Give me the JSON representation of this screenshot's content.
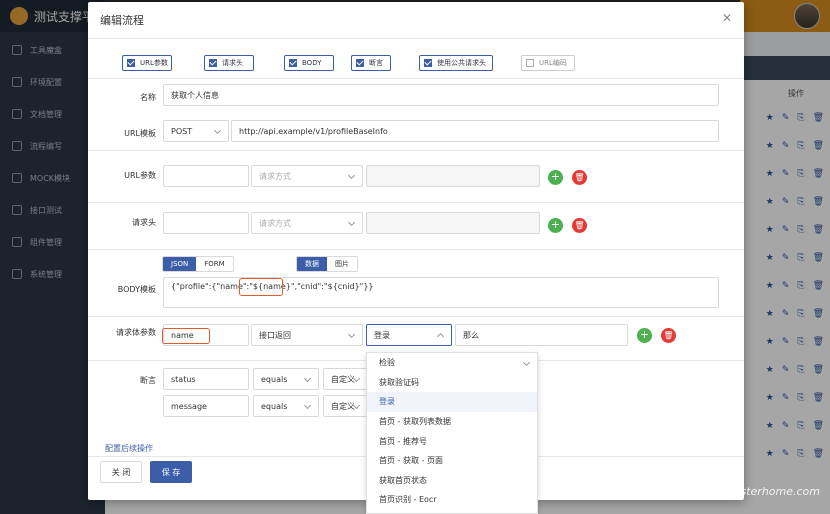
{
  "app": {
    "brand": "测试支撑平"
  },
  "sidebar": {
    "items": [
      {
        "label": "工具魔盒",
        "icon": "gear-icon"
      },
      {
        "label": "环境配置",
        "icon": "send-icon"
      },
      {
        "label": "文档管理",
        "icon": "doc-icon"
      },
      {
        "label": "流程编写",
        "icon": "flow-icon"
      },
      {
        "label": "MOCK模块",
        "icon": "mock-icon"
      },
      {
        "label": "接口测试",
        "icon": "grid-icon"
      },
      {
        "label": "组件管理",
        "icon": "tree-icon"
      },
      {
        "label": "系统管理",
        "icon": "list-icon"
      }
    ]
  },
  "background": {
    "op_header": "操作"
  },
  "modal": {
    "title": "编辑流程",
    "checkboxes": [
      {
        "label": "URL参数",
        "checked": true
      },
      {
        "label": "请求头",
        "checked": true
      },
      {
        "label": "BODY",
        "checked": true
      },
      {
        "label": "断言",
        "checked": true
      },
      {
        "label": "使用公共请求头",
        "checked": true
      },
      {
        "label": "URL编码",
        "checked": false
      }
    ],
    "name": {
      "label": "名称",
      "value": "获取个人信息"
    },
    "url": {
      "label": "URL模板",
      "method": "POST",
      "value": "http://api.example/v1/profileBaseInfo"
    },
    "url_params": {
      "label": "URL参数",
      "mode_placeholder": "请求方式"
    },
    "headers": {
      "label": "请求头",
      "mode_placeholder": "请求方式"
    },
    "body": {
      "label": "BODY模板",
      "tabs_format": [
        "JSON",
        "FORM"
      ],
      "tabs_type": [
        "数据",
        "图片"
      ],
      "value": "{\"profile\":{\"name\":\"${name}\",\"cnid\":\"${cnid}\"}}"
    },
    "body_params": {
      "label": "请求体参数",
      "name": "name",
      "source": "接口返回",
      "flow": "登录",
      "target": "那么"
    },
    "assert": {
      "label": "断言",
      "rows": [
        {
          "field": "status",
          "op": "equals",
          "kind": "自定义"
        },
        {
          "field": "message",
          "op": "equals",
          "kind": "自定义"
        }
      ]
    },
    "followup_link": "配置后续操作",
    "close_label": "关 闭",
    "save_label": "保 存"
  },
  "dropdown": {
    "items": [
      "检验",
      "获取验证码",
      "登录",
      "首页 - 获取列表数据",
      "首页 - 推荐号",
      "首页 - 获取 - 页面",
      "获取首页状态",
      "首页识别 - Eocr"
    ],
    "selected_index": 2
  },
  "watermark": "testerhome.com"
}
